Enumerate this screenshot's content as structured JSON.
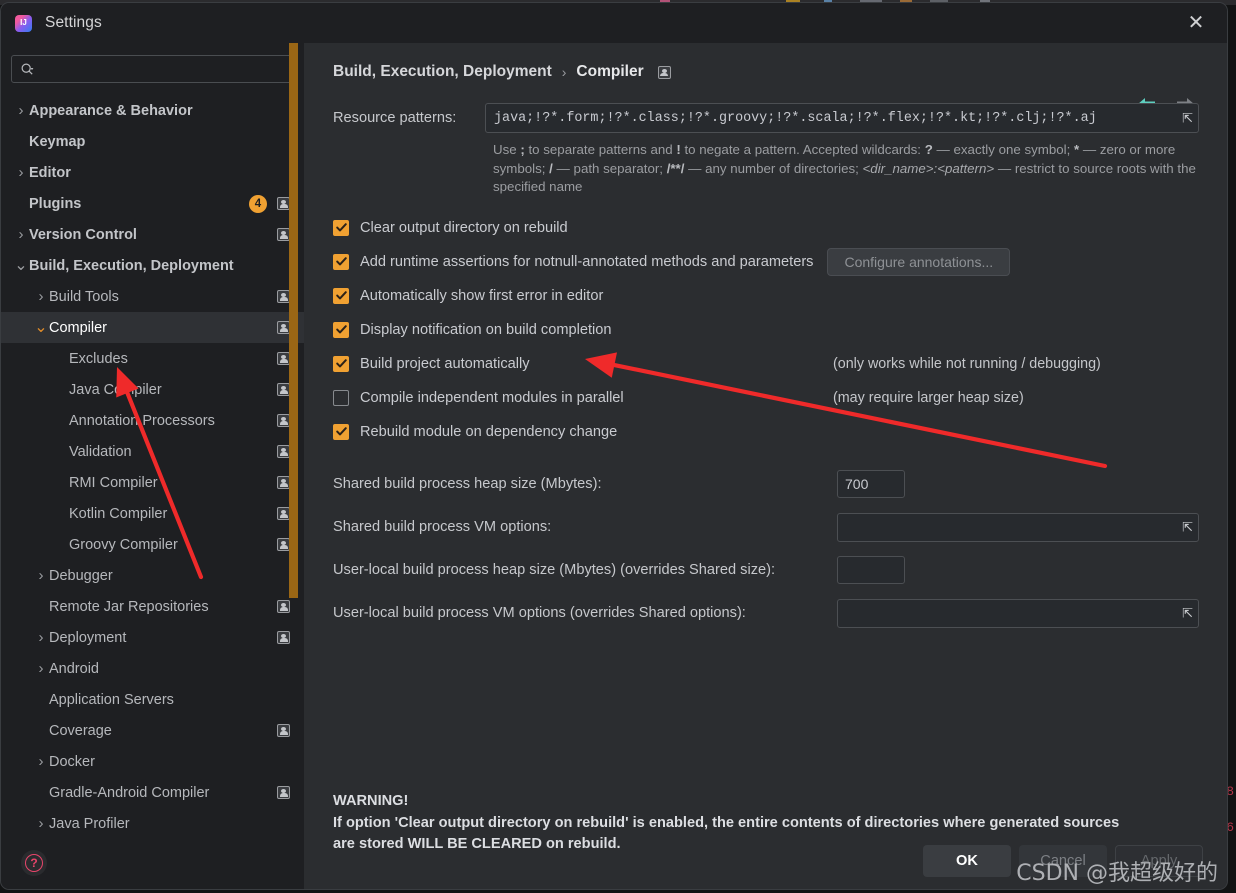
{
  "window": {
    "title": "Settings",
    "app_icon": "intellij-idea-icon",
    "close_icon": "close-icon"
  },
  "sidebar": {
    "search": {
      "placeholder": "",
      "value": "",
      "icon": "search-icon"
    },
    "items": [
      {
        "label": "Appearance & Behavior",
        "indent": 0,
        "twisty": "collapsed",
        "bold": true
      },
      {
        "label": "Keymap",
        "indent": 0,
        "twisty": "none",
        "bold": true
      },
      {
        "label": "Editor",
        "indent": 0,
        "twisty": "collapsed",
        "bold": true
      },
      {
        "label": "Plugins",
        "indent": 0,
        "twisty": "none",
        "bold": true,
        "badge": "4",
        "project_icon": true
      },
      {
        "label": "Version Control",
        "indent": 0,
        "twisty": "collapsed",
        "bold": true,
        "project_icon": true
      },
      {
        "label": "Build, Execution, Deployment",
        "indent": 0,
        "twisty": "expanded",
        "bold": true
      },
      {
        "label": "Build Tools",
        "indent": 1,
        "twisty": "collapsed",
        "project_icon": true
      },
      {
        "label": "Compiler",
        "indent": 1,
        "twisty": "expanded",
        "selected": true,
        "project_icon": true
      },
      {
        "label": "Excludes",
        "indent": 2,
        "twisty": "none",
        "project_icon": true
      },
      {
        "label": "Java Compiler",
        "indent": 2,
        "twisty": "none",
        "project_icon": true
      },
      {
        "label": "Annotation Processors",
        "indent": 2,
        "twisty": "none",
        "project_icon": true
      },
      {
        "label": "Validation",
        "indent": 2,
        "twisty": "none",
        "project_icon": true
      },
      {
        "label": "RMI Compiler",
        "indent": 2,
        "twisty": "none",
        "project_icon": true
      },
      {
        "label": "Kotlin Compiler",
        "indent": 2,
        "twisty": "none",
        "project_icon": true
      },
      {
        "label": "Groovy Compiler",
        "indent": 2,
        "twisty": "none",
        "project_icon": true
      },
      {
        "label": "Debugger",
        "indent": 1,
        "twisty": "collapsed"
      },
      {
        "label": "Remote Jar Repositories",
        "indent": 1,
        "twisty": "none",
        "project_icon": true
      },
      {
        "label": "Deployment",
        "indent": 1,
        "twisty": "collapsed",
        "project_icon": true
      },
      {
        "label": "Android",
        "indent": 1,
        "twisty": "collapsed"
      },
      {
        "label": "Application Servers",
        "indent": 1,
        "twisty": "none"
      },
      {
        "label": "Coverage",
        "indent": 1,
        "twisty": "none",
        "project_icon": true
      },
      {
        "label": "Docker",
        "indent": 1,
        "twisty": "collapsed"
      },
      {
        "label": "Gradle-Android Compiler",
        "indent": 1,
        "twisty": "none",
        "project_icon": true
      },
      {
        "label": "Java Profiler",
        "indent": 1,
        "twisty": "collapsed"
      }
    ],
    "help_button": "?"
  },
  "breadcrumb": {
    "parent": "Build, Execution, Deployment",
    "separator": "›",
    "current": "Compiler",
    "back_icon": "back-arrow-icon",
    "forward_icon": "forward-arrow-icon"
  },
  "resource_patterns": {
    "label": "Resource patterns:",
    "value": "java;!?*.form;!?*.class;!?*.groovy;!?*.scala;!?*.flex;!?*.kt;!?*.clj;!?*.aj",
    "expand_icon": "expand-icon",
    "hint_line1_a": "Use ",
    "hint_b1": ";",
    "hint_line1_b": " to separate patterns and ",
    "hint_b2": "!",
    "hint_line1_c": " to negate a pattern. Accepted wildcards: ",
    "hint_b3": "?",
    "hint_line1_d": " — exactly one symbol; ",
    "hint_b4": "*",
    "hint_line1_e": " — zero or more symbols; ",
    "hint_b5": "/",
    "hint_line1_f": " — path separator; ",
    "hint_b6": "/**/",
    "hint_line1_g": " — any number of directories; ",
    "hint_i1": "<dir_name>:<pattern>",
    "hint_line1_h": " — restrict to source roots with the specified name"
  },
  "checkboxes": [
    {
      "label": "Clear output directory on rebuild",
      "checked": true,
      "mnemonic_index": 2
    },
    {
      "label": "Add runtime assertions for notnull-annotated methods and parameters",
      "checked": true,
      "mnemonic_index": 12,
      "button": "Configure annotations..."
    },
    {
      "label": "Automatically show first error in editor",
      "checked": true,
      "mnemonic_index": 28
    },
    {
      "label": "Display notification on build completion",
      "checked": true
    },
    {
      "label": "Build project automatically",
      "checked": true,
      "note": "(only works while not running / debugging)"
    },
    {
      "label": "Compile independent modules in parallel",
      "checked": false,
      "note": "(may require larger heap size)"
    },
    {
      "label": "Rebuild module on dependency change",
      "checked": true
    }
  ],
  "build_fields": [
    {
      "label": "Shared build process heap size (Mbytes):",
      "value": "700",
      "kind": "small"
    },
    {
      "label": "Shared build process VM options:",
      "value": "",
      "kind": "wide",
      "expand_icon": "expand-icon"
    },
    {
      "label": "User-local build process heap size (Mbytes) (overrides Shared size):",
      "value": "",
      "kind": "small"
    },
    {
      "label": "User-local build process VM options (overrides Shared options):",
      "value": "",
      "kind": "wide",
      "expand_icon": "expand-icon"
    }
  ],
  "warning": {
    "line1": "WARNING!",
    "line2": "If option 'Clear output directory on rebuild' is enabled, the entire contents of directories where generated sources",
    "line3": "are stored WILL BE CLEARED on rebuild."
  },
  "buttons": {
    "ok": "OK",
    "cancel": "Cancel",
    "apply": "Apply"
  },
  "annotations": {
    "arrow_color": "#ef2a2a",
    "arrow1_target": "Build project automatically",
    "arrow2_target": "Excludes"
  },
  "watermark": "CSDN @我超级好的",
  "colors": {
    "accent_orange": "#f0a132",
    "dialog_bg": "#2b2d30",
    "sidebar_bg": "#1e1f22",
    "scrollbar": "#9a6615",
    "help_pink": "#e8456b"
  }
}
